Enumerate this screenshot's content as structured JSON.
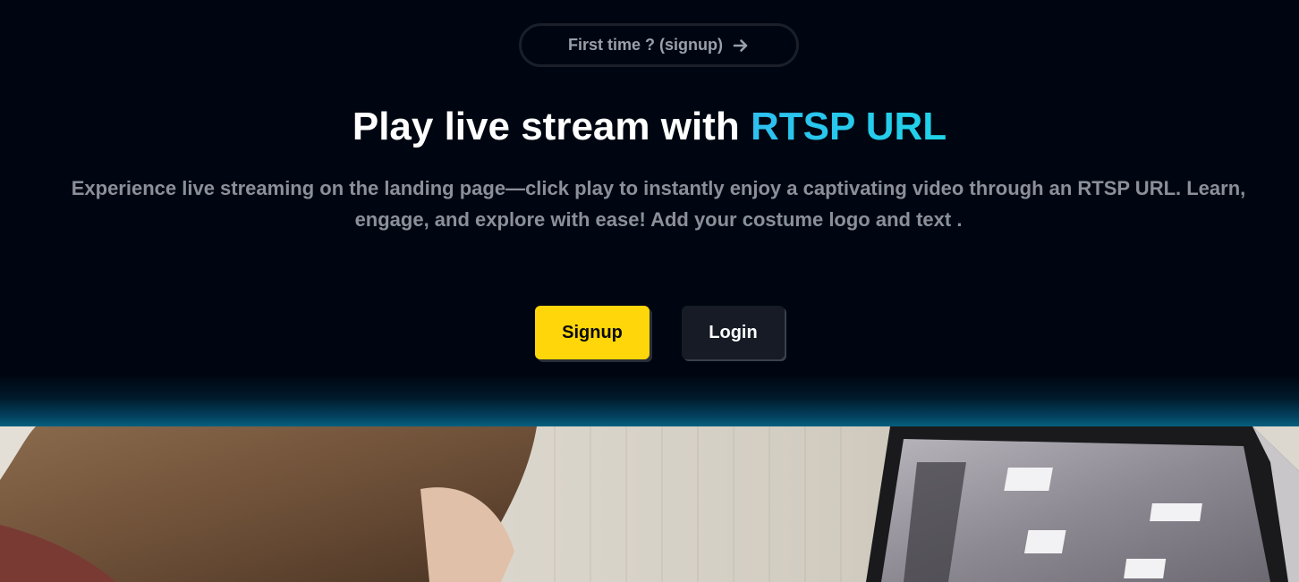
{
  "hero": {
    "pill_label": "First time ? (signup)",
    "pill_icon": "arrow-right-icon",
    "title_main": "Play live stream with ",
    "title_accent": "RTSP URL",
    "description": "Experience live streaming on the landing page—click play to instantly enjoy a captivating video through an RTSP URL. Learn, engage, and explore with ease! Add your costume logo and text .",
    "signup_label": "Signup",
    "login_label": "Login"
  },
  "colors": {
    "background": "#000611",
    "accent_cyan": "#2ec0f0",
    "signup_yellow": "#ffd60a",
    "login_dark": "#161b25"
  }
}
